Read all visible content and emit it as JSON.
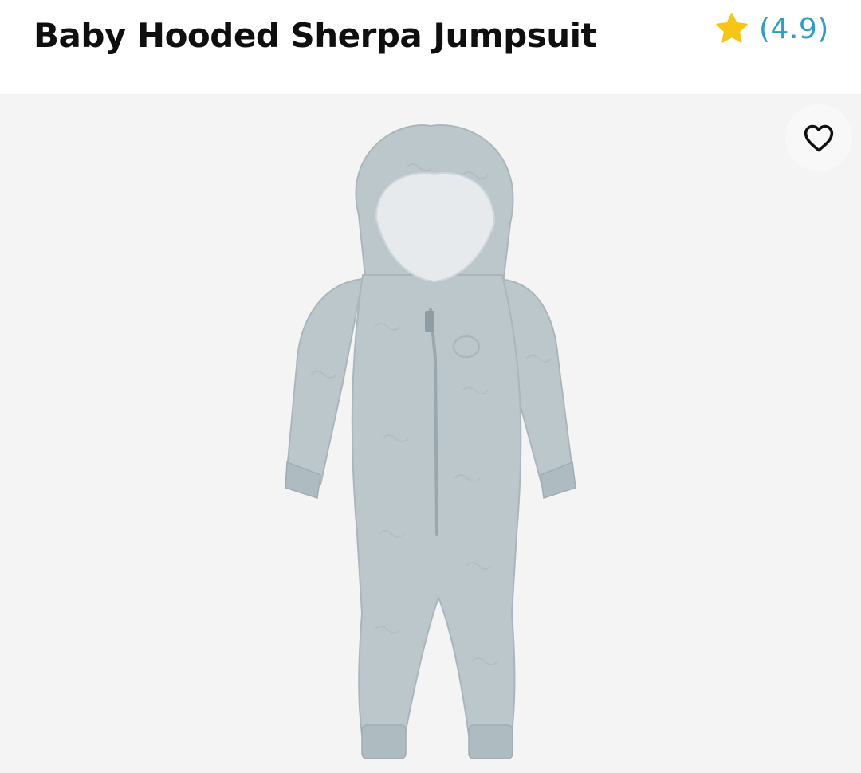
{
  "product": {
    "title": "Baby Hooded Sherpa Jumpsuit",
    "rating_display": "(4.9)"
  },
  "icons": {
    "rating": "star-icon",
    "favorite": "heart-outline-icon"
  },
  "colors": {
    "star": "#f6c515",
    "rating_text": "#2e9ec6",
    "image_background": "#f4f4f4",
    "garment": "#bcc7cc"
  }
}
